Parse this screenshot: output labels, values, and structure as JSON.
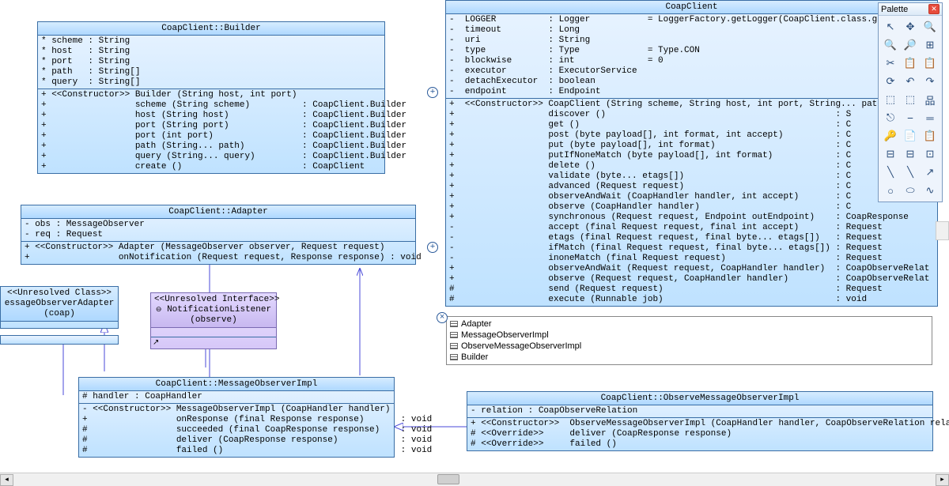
{
  "palette": {
    "title": "Palette"
  },
  "builder": {
    "title": "CoapClient::Builder",
    "attrs": [
      "* scheme : String",
      "* host   : String",
      "* port   : String",
      "* path   : String[]",
      "* query  : String[]"
    ],
    "ops": [
      "+ <<Constructor>> Builder (String host, int port)",
      "+                 scheme (String scheme)          : CoapClient.Builder",
      "+                 host (String host)              : CoapClient.Builder",
      "+                 port (String port)              : CoapClient.Builder",
      "+                 port (int port)                 : CoapClient.Builder",
      "+                 path (String... path)           : CoapClient.Builder",
      "+                 query (String... query)         : CoapClient.Builder",
      "+                 create ()                       : CoapClient"
    ]
  },
  "adapter": {
    "title": "CoapClient::Adapter",
    "attrs": [
      "- obs : MessageObserver",
      "- req : Request"
    ],
    "ops": [
      "+ <<Constructor>> Adapter (MessageObserver observer, Request request)",
      "+                 onNotification (Request request, Response response) : void"
    ]
  },
  "unresolvedClass": {
    "stereo": "<<Unresolved Class>>",
    "name": "essageObserverAdapter",
    "pkg": "(coap)"
  },
  "unresolvedIface": {
    "stereo": "<<Unresolved Interface>>",
    "name": "NotificationListener",
    "pkg": "(observe)"
  },
  "msgObs": {
    "title": "CoapClient::MessageObserverImpl",
    "attrs": [
      "# handler : CoapHandler"
    ],
    "ops": [
      "- <<Constructor>> MessageObserverImpl (CoapHandler handler)",
      "+                 onResponse (final Response response)       : void",
      "#                 succeeded (final CoapResponse response)    : void",
      "#                 deliver (CoapResponse response)            : void",
      "#                 failed ()                                  : void"
    ]
  },
  "obsMsg": {
    "title": "CoapClient::ObserveMessageObserverImpl",
    "attrs": [
      "- relation : CoapObserveRelation"
    ],
    "ops": [
      "+ <<Constructor>>  ObserveMessageObserverImpl (CoapHandler handler, CoapObserveRelation relation)",
      "# <<Override>>     deliver (CoapResponse response)",
      "# <<Override>>     failed ()"
    ]
  },
  "coapClient": {
    "title": "CoapClient",
    "attrs": [
      "-  LOGGER          : Logger           = LoggerFactory.getLogger(CoapClient.class.getCanon",
      "-  timeout         : Long",
      "-  uri             : String",
      "-  type            : Type             = Type.CON",
      "-  blockwise       : int              = 0",
      "-  executor        : ExecutorService",
      "-  detachExecutor  : boolean",
      "-  endpoint        : Endpoint"
    ],
    "ops": [
      "+  <<Constructor>> CoapClient (String scheme, String host, int port, String... path)",
      "+                  discover ()                                            : S",
      "+                  get ()                                                 : C",
      "+                  post (byte payload[], int format, int accept)          : C",
      "+                  put (byte payload[], int format)                       : C",
      "+                  putIfNoneMatch (byte payload[], int format)            : C",
      "+                  delete ()                                              : C",
      "+                  validate (byte... etags[])                             : C",
      "+                  advanced (Request request)                             : C",
      "+                  observeAndWait (CoapHandler handler, int accept)       : C",
      "+                  observe (CoapHandler handler)                          : C",
      "+                  synchronous (Request request, Endpoint outEndpoint)    : CoapResponse",
      "-                  accept (final Request request, final int accept)       : Request",
      "-                  etags (final Request request, final byte... etags[])   : Request",
      "-                  ifMatch (final Request request, final byte... etags[]) : Request",
      "-                  inoneMatch (final Request request)                     : Request",
      "+                  observeAndWait (Request request, CoapHandler handler)  : CoapObserveRelat",
      "+                  observe (Request request, CoapHandler handler)         : CoapObserveRelat",
      "#                  send (Request request)                                 : Request",
      "#                  execute (Runnable job)                                 : void"
    ]
  },
  "nested": {
    "items": [
      "Adapter",
      "MessageObserverImpl",
      "ObserveMessageObserverImpl",
      "Builder"
    ]
  },
  "tools": [
    "↖",
    "✥",
    "🔍",
    "🔍",
    "🔎",
    "⊞",
    "✂",
    "📋",
    "📋",
    "⟳",
    "↶",
    "↷",
    "⬚",
    "⬚",
    "品",
    "⎋",
    "⎯",
    "═",
    "🔑",
    "📄",
    "📋",
    "⊟",
    "⊟",
    "⊡",
    "╲",
    "╲",
    "↗",
    "○",
    "⬭",
    "∿"
  ]
}
